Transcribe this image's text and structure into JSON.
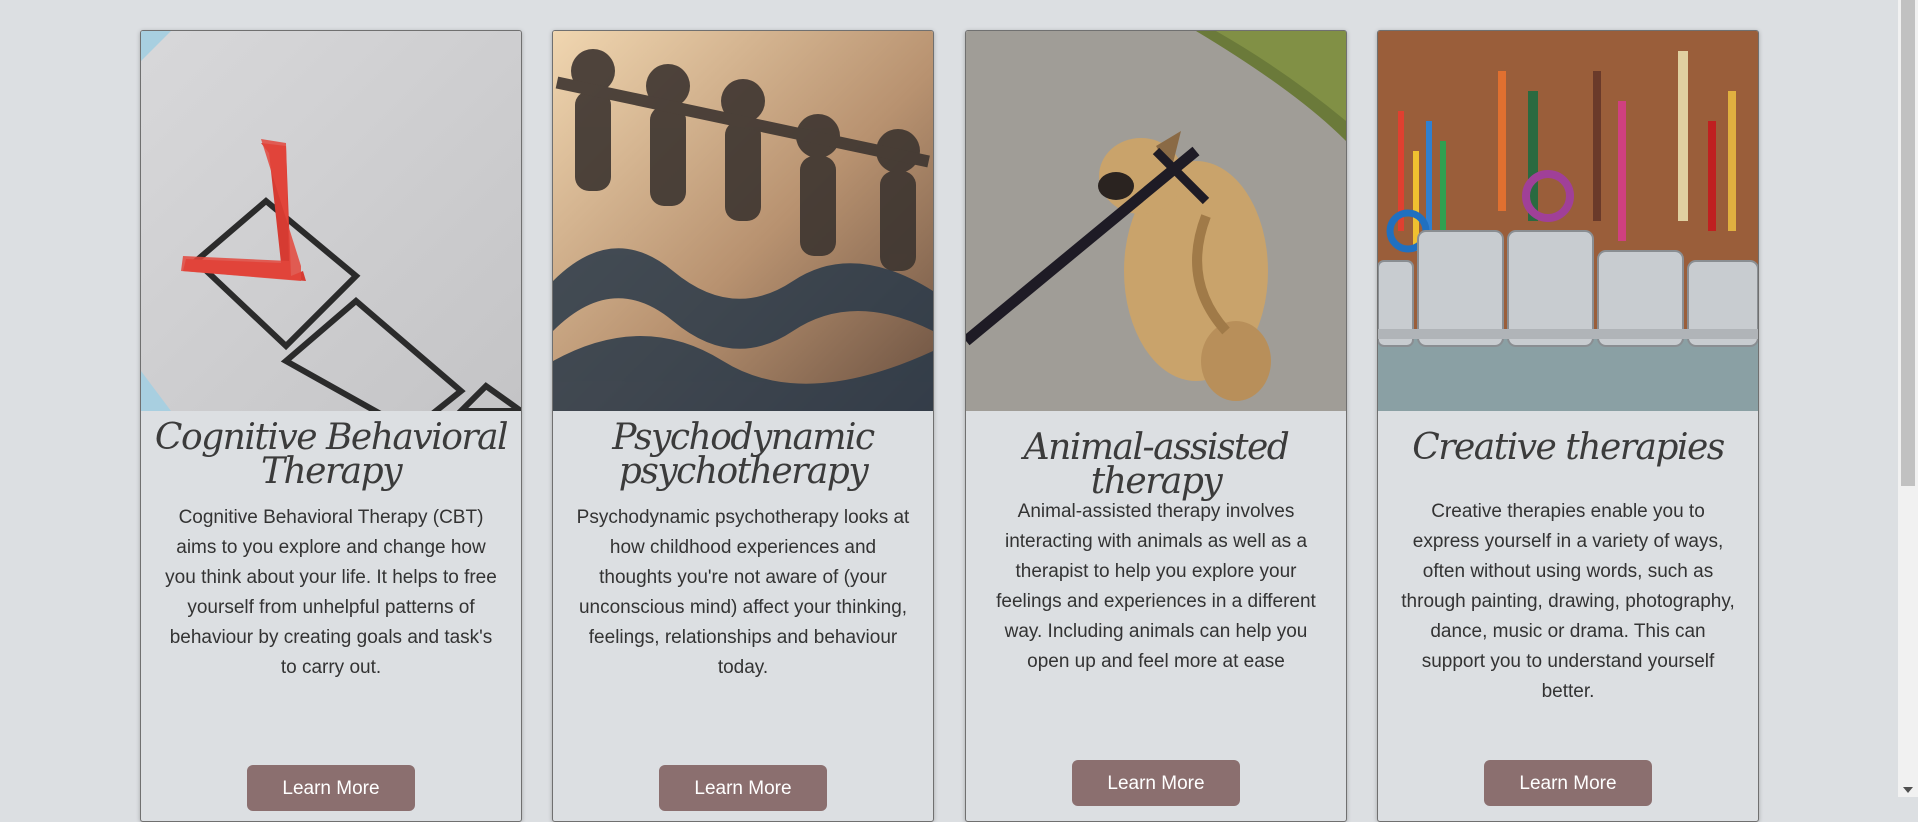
{
  "cards": [
    {
      "title": "Cognitive Behavioral Therapy",
      "description": "Cognitive Behavioral Therapy (CBT) aims to you explore and change how you think about your life. It helps to free yourself from unhelpful patterns of behaviour by creating goals and task's to carry out.",
      "button_label": "Learn More",
      "image": "checklist-checkmark-photo"
    },
    {
      "title": "Psychodynamic psychotherapy",
      "description": "Psychodynamic psychotherapy looks at how childhood experiences and thoughts you're not aware of (your unconscious mind) affect your thinking, feelings, relationships and behaviour today.",
      "button_label": "Learn More",
      "image": "paper-people-chain-photo"
    },
    {
      "title": "Animal-assisted therapy",
      "description": "Animal-assisted therapy involves interacting with animals as well as a therapist to help you explore your feelings and experiences in a different way. Including animals can help you open up and feel more at ease",
      "button_label": "Learn More",
      "image": "dog-on-leash-photo"
    },
    {
      "title": "Creative therapies",
      "description": "Creative therapies enable you to express yourself in a variety of ways, often without using words, such as through painting, drawing, photography, dance, music or drama. This can support you to understand yourself better.",
      "button_label": "Learn More",
      "image": "art-supplies-photo"
    }
  ],
  "colors": {
    "background": "#dcdfe2",
    "button": "#8b6f6f",
    "title_text": "#3b3b3b"
  }
}
